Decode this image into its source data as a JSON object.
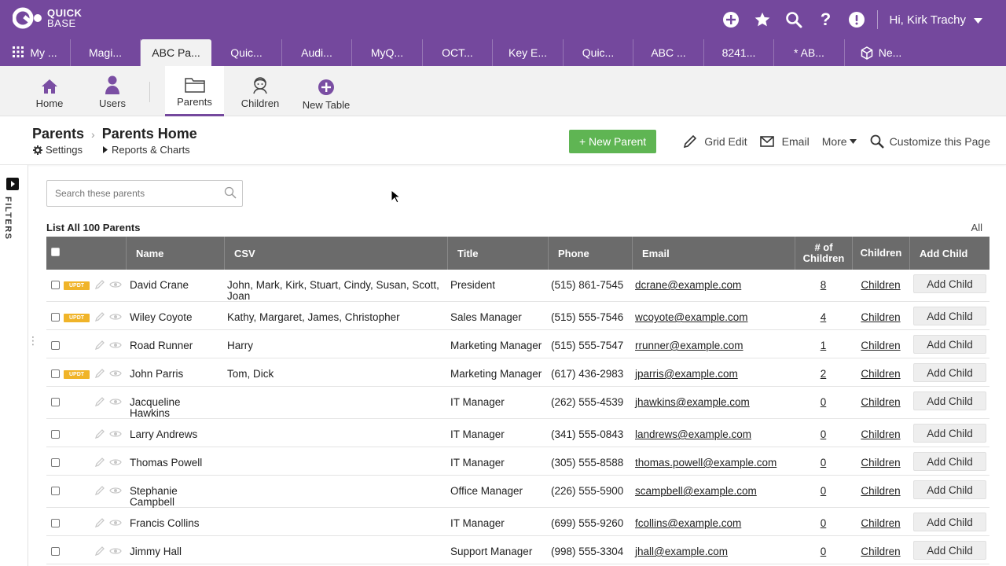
{
  "app": {
    "logo_line1": "QUICK",
    "logo_line2": "BASE",
    "user_label": "Hi, Kirk Trachy"
  },
  "app_tabs": [
    {
      "label": "My ...",
      "active": false
    },
    {
      "label": "Magi...",
      "active": false
    },
    {
      "label": "ABC Pa...",
      "active": true
    },
    {
      "label": "Quic...",
      "active": false
    },
    {
      "label": "Audi...",
      "active": false
    },
    {
      "label": "MyQ...",
      "active": false
    },
    {
      "label": "OCT...",
      "active": false
    },
    {
      "label": "Key E...",
      "active": false
    },
    {
      "label": "Quic...",
      "active": false
    },
    {
      "label": "ABC ...",
      "active": false
    },
    {
      "label": "8241...",
      "active": false
    },
    {
      "label": "* AB...",
      "active": false
    },
    {
      "label": "Ne...",
      "active": false
    }
  ],
  "table_nav": {
    "home": "Home",
    "users": "Users",
    "parents": "Parents",
    "children": "Children",
    "new_table": "New Table"
  },
  "header": {
    "crumb_table": "Parents",
    "crumb_page": "Parents Home",
    "settings": "Settings",
    "reports": "Reports & Charts",
    "new_parent": "+ New Parent",
    "grid_edit": "Grid Edit",
    "email": "Email",
    "more": "More",
    "customize": "Customize this Page"
  },
  "filters_label": "FILTERS",
  "search": {
    "placeholder": "Search these parents",
    "value": ""
  },
  "list": {
    "title": "List All 100 Parents",
    "all_link": "All"
  },
  "columns": {
    "name": "Name",
    "csv": "CSV",
    "title": "Title",
    "phone": "Phone",
    "email": "Email",
    "num_children": "# of Children",
    "children": "Children",
    "add_child": "Add Child"
  },
  "updt_badge": "UPDT",
  "rows": [
    {
      "name": "David Crane",
      "csv": "John, Mark, Kirk, Stuart, Cindy, Susan, Scott, Joan",
      "title": "President",
      "phone": "(515) 861-7545",
      "email": "dcrane@example.com",
      "count": "8",
      "children": "Children",
      "add": "Add Child",
      "updt": true
    },
    {
      "name": "Wiley Coyote",
      "csv": "Kathy, Margaret, James, Christopher",
      "title": "Sales Manager",
      "phone": "(515) 555-7546",
      "email": "wcoyote@example.com",
      "count": "4",
      "children": "Children",
      "add": "Add Child",
      "updt": true
    },
    {
      "name": "Road Runner",
      "csv": "Harry",
      "title": "Marketing Manager",
      "phone": "(515) 555-7547",
      "email": "rrunner@example.com",
      "count": "1",
      "children": "Children",
      "add": "Add Child",
      "updt": false
    },
    {
      "name": "John Parris",
      "csv": "Tom, Dick",
      "title": "Marketing Manager",
      "phone": "(617) 436-2983",
      "email": "jparris@example.com",
      "count": "2",
      "children": "Children",
      "add": "Add Child",
      "updt": true
    },
    {
      "name": "Jacqueline Hawkins",
      "csv": "",
      "title": "IT Manager",
      "phone": "(262) 555-4539",
      "email": "jhawkins@example.com",
      "count": "0",
      "children": "Children",
      "add": "Add Child",
      "updt": false
    },
    {
      "name": "Larry Andrews",
      "csv": "",
      "title": "IT Manager",
      "phone": "(341) 555-0843",
      "email": "landrews@example.com",
      "count": "0",
      "children": "Children",
      "add": "Add Child",
      "updt": false
    },
    {
      "name": "Thomas Powell",
      "csv": "",
      "title": "IT Manager",
      "phone": "(305) 555-8588",
      "email": "thomas.powell@example.com",
      "count": "0",
      "children": "Children",
      "add": "Add Child",
      "updt": false
    },
    {
      "name": "Stephanie Campbell",
      "csv": "",
      "title": "Office Manager",
      "phone": "(226) 555-5900",
      "email": "scampbell@example.com",
      "count": "0",
      "children": "Children",
      "add": "Add Child",
      "updt": false
    },
    {
      "name": "Francis Collins",
      "csv": "",
      "title": "IT Manager",
      "phone": "(699) 555-9260",
      "email": "fcollins@example.com",
      "count": "0",
      "children": "Children",
      "add": "Add Child",
      "updt": false
    },
    {
      "name": "Jimmy Hall",
      "csv": "",
      "title": "Support Manager",
      "phone": "(998) 555-3304",
      "email": "jhall@example.com",
      "count": "0",
      "children": "Children",
      "add": "Add Child",
      "updt": false
    }
  ]
}
